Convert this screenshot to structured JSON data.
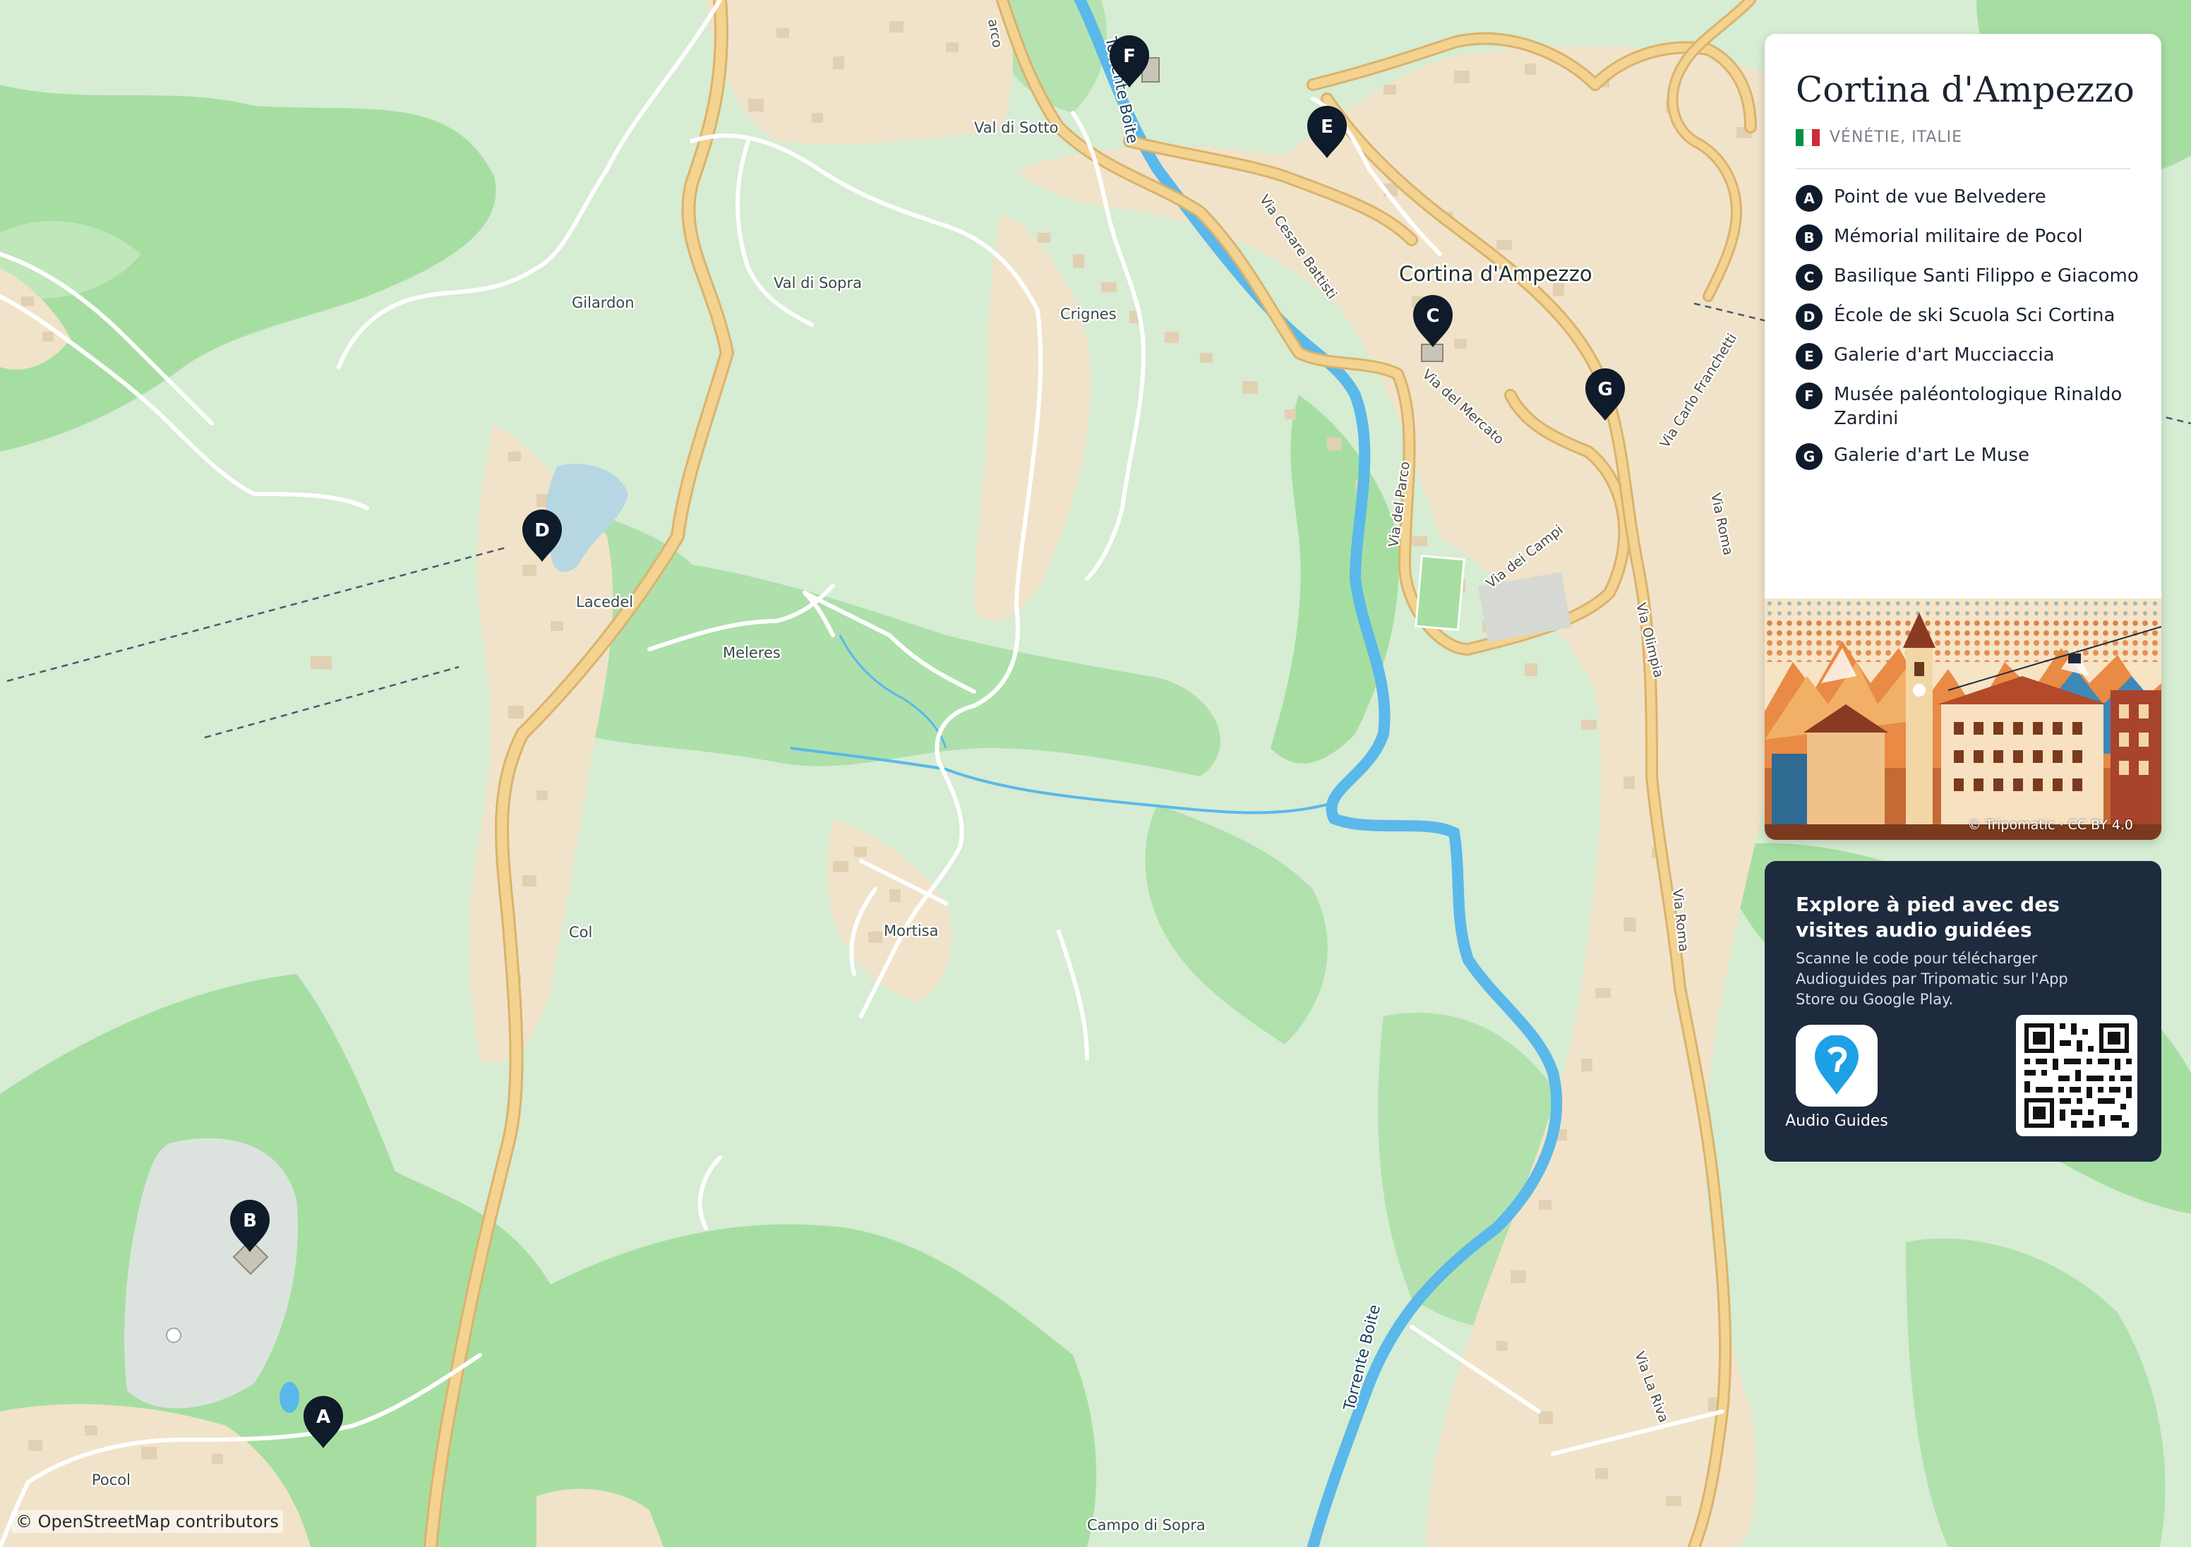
{
  "map": {
    "colors": {
      "meadow": "#d6ecd3",
      "forest": "#a6dea2",
      "built": "#f1e3c9",
      "building": "#e2d0b2",
      "river": "#5ab8ea",
      "major_road": "#f4d290",
      "minor_road": "#ffffff",
      "marker": "#0f1a2a"
    },
    "place_labels": [
      {
        "id": "val-di-sotto",
        "text": "Val di Sotto"
      },
      {
        "id": "gilardon",
        "text": "Gilardon"
      },
      {
        "id": "val-di-sopra",
        "text": "Val di Sopra"
      },
      {
        "id": "crignes",
        "text": "Crignes"
      },
      {
        "id": "lacedel",
        "text": "Lacedel"
      },
      {
        "id": "meleres",
        "text": "Meleres"
      },
      {
        "id": "col",
        "text": "Col"
      },
      {
        "id": "mortisa",
        "text": "Mortisa"
      },
      {
        "id": "pocol",
        "text": "Pocol"
      },
      {
        "id": "campo-di-sopra",
        "text": "Campo di Sopra"
      }
    ],
    "town_label": "Cortina d'Ampezzo",
    "street_labels": [
      {
        "id": "via-cesare-battisti",
        "text": "Via Cesare Battisti"
      },
      {
        "id": "via-del-mercato",
        "text": "Via del Mercato"
      },
      {
        "id": "via-del-parco",
        "text": "Via del Parco"
      },
      {
        "id": "via-dei-campi",
        "text": "Via dei Campi"
      },
      {
        "id": "via-olimpia",
        "text": "Via Olimpia"
      },
      {
        "id": "via-roma-1",
        "text": "Via Roma"
      },
      {
        "id": "via-roma-2",
        "text": "Via Roma"
      },
      {
        "id": "via-carlo-franchetti",
        "text": "Via Carlo Franchetti"
      },
      {
        "id": "via-la-riva",
        "text": "Via La Riva"
      },
      {
        "id": "via-del-parco-top",
        "text": "arco"
      }
    ],
    "river_labels": [
      {
        "id": "torrente-boite-north",
        "text": "Torrente Boite"
      },
      {
        "id": "torrente-boite-south",
        "text": "Torrente Boite"
      }
    ],
    "markers": [
      {
        "letter": "A"
      },
      {
        "letter": "B"
      },
      {
        "letter": "C"
      },
      {
        "letter": "D"
      },
      {
        "letter": "E"
      },
      {
        "letter": "F"
      },
      {
        "letter": "G"
      }
    ],
    "attribution": "© OpenStreetMap contributors"
  },
  "legend": {
    "title": "Cortina d'Ampezzo",
    "region": "VÉNÉTIE, ITALIE",
    "flag_colors": [
      "#009246",
      "#ffffff",
      "#ce2b37"
    ],
    "items": [
      {
        "letter": "A",
        "label": "Point de vue Belvedere"
      },
      {
        "letter": "B",
        "label": "Mémorial militaire de Pocol"
      },
      {
        "letter": "C",
        "label": "Basilique Santi Filippo e Giacomo"
      },
      {
        "letter": "D",
        "label": "École de ski Scuola Sci Cortina"
      },
      {
        "letter": "E",
        "label": "Galerie d'art Mucciaccia"
      },
      {
        "letter": "F",
        "label": "Musée paléontologique Rinaldo Zardini"
      },
      {
        "letter": "G",
        "label": "Galerie d'art Le Muse"
      }
    ],
    "illustration_credit": "© Tripomatic · CC BY 4.0"
  },
  "audio": {
    "title": "Explore à pied avec des visites audio guidées",
    "description": "Scanne le code pour télécharger Audioguides par Tripomatic sur l'App Store ou Google Play.",
    "app_label": "Audio Guides",
    "app_icon": "map-pin-icon",
    "qr_icon": "qr-code"
  }
}
